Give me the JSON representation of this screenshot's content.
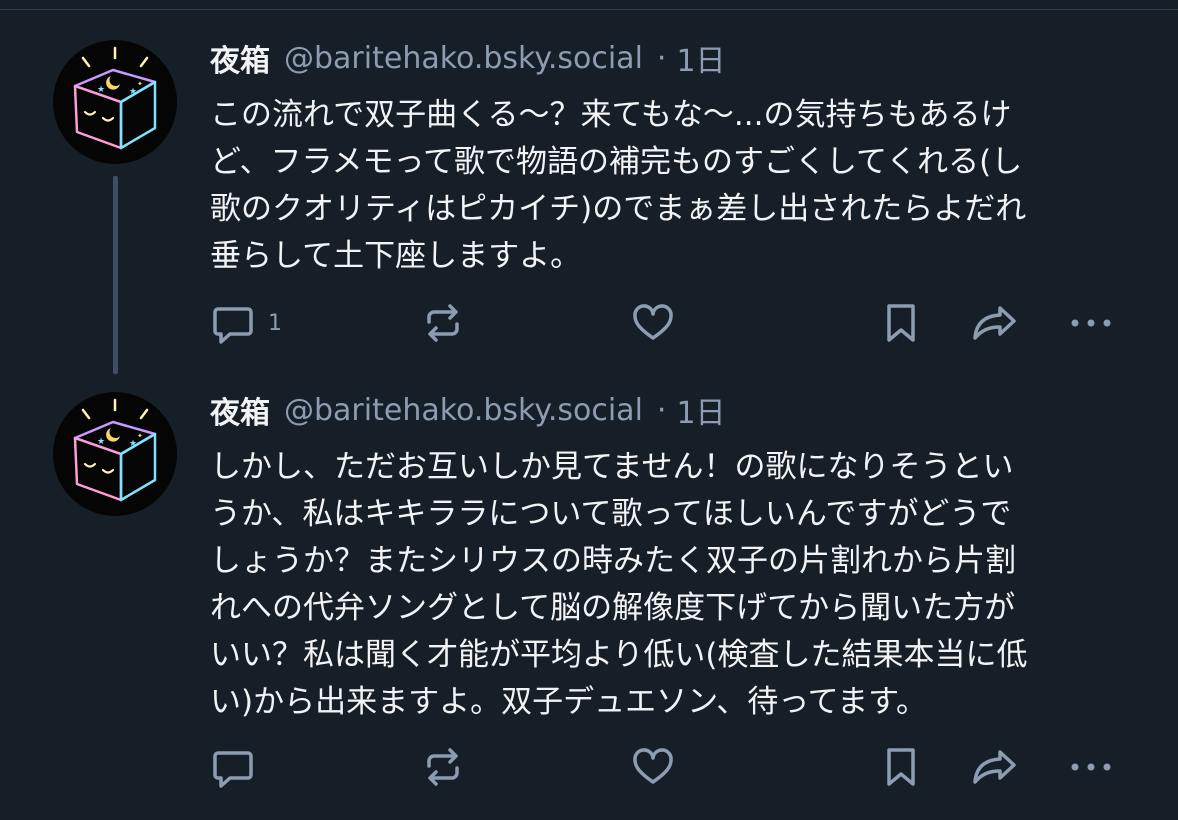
{
  "posts": [
    {
      "display_name": "夜箱",
      "handle": "@baritehako.bsky.social",
      "separator": "·",
      "time": "1日",
      "lines": [
        "この流れで双子曲くる〜？来てもな〜...の気持ちもあるけ",
        "ど、フラメモって歌で物語の補完ものすごくしてくれる(し",
        "歌のクオリティはピカイチ)のでまぁ差し出されたらよだれ",
        "垂らして土下座しますよ。"
      ],
      "reply_count": "1",
      "icons": [
        "reply-icon",
        "repost-icon",
        "like-icon",
        "bookmark-icon",
        "share-icon",
        "more-icon"
      ]
    },
    {
      "display_name": "夜箱",
      "handle": "@baritehako.bsky.social",
      "separator": "·",
      "time": "1日",
      "lines": [
        "しかし、ただお互いしか見てません！の歌になりそうとい",
        "うか、私はキキララについて歌ってほしいんですがどうで",
        "しょうか？またシリウスの時みたく双子の片割れから片割",
        "れへの代弁ソングとして脳の解像度下げてから聞いた方が",
        "いい？私は聞く才能が平均より低い(検査した結果本当に低",
        "い)から出来ますよ。双子デュエソン、待ってます。"
      ],
      "reply_count": "",
      "icons": [
        "reply-icon",
        "repost-icon",
        "like-icon",
        "bookmark-icon",
        "share-icon",
        "more-icon"
      ]
    }
  ],
  "colors": {
    "background": "#161e27",
    "text": "#f1f3f5",
    "muted": "#8c9cb1",
    "thread_line": "#3f4e61",
    "avatar_neon": [
      "#ffd36b",
      "#c89bff",
      "#7fe3ff",
      "#ff9bd5"
    ]
  }
}
